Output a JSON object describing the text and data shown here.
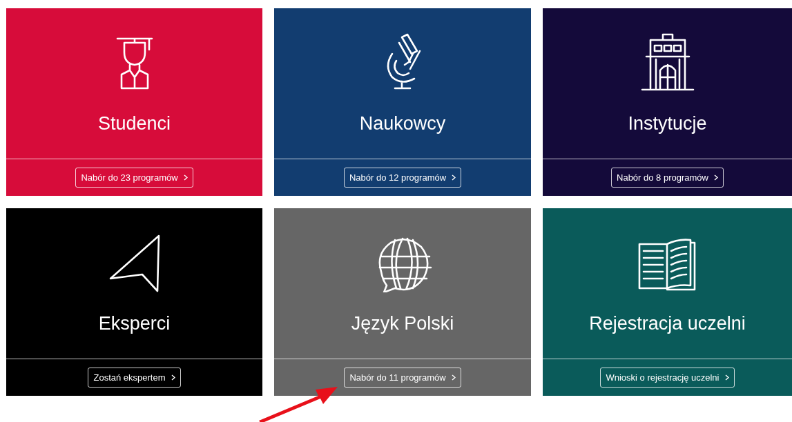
{
  "cards": [
    {
      "title": "Studenci",
      "kind": "graduate",
      "color": "#d70c3a",
      "button": "Nabór do 23 programów"
    },
    {
      "title": "Naukowcy",
      "kind": "microscope",
      "color": "#123d70",
      "button": "Nabór do 12 programów"
    },
    {
      "title": "Instytucje",
      "kind": "building",
      "color": "#140a3a",
      "button": "Nabór do 8 programów"
    },
    {
      "title": "Eksperci",
      "kind": "cursor",
      "color": "#000000",
      "button": "Zostań ekspertem"
    },
    {
      "title": "Język Polski",
      "kind": "globe",
      "color": "#666666",
      "button": "Nabór do 11 programów"
    },
    {
      "title": "Rejestracja uczelni",
      "kind": "book",
      "color": "#0a5b5a",
      "button": "Wnioski o rejestrację uczelni"
    }
  ]
}
